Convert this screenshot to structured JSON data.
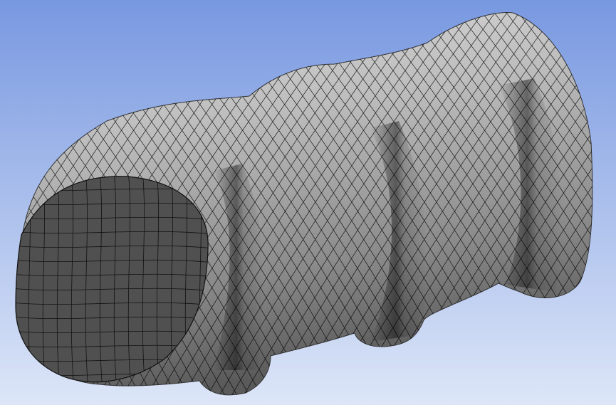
{
  "viewport": {
    "background_top": "#7898e0",
    "background_bottom": "#dde6f8"
  },
  "model": {
    "icon": "meshed-helical-screw-icon",
    "body_light": "#c9c9c9",
    "body_mid": "#9b9b9b",
    "body_dark": "#555555",
    "end_face": "#505050",
    "mesh_line": "#000000",
    "flight_count": 3
  }
}
